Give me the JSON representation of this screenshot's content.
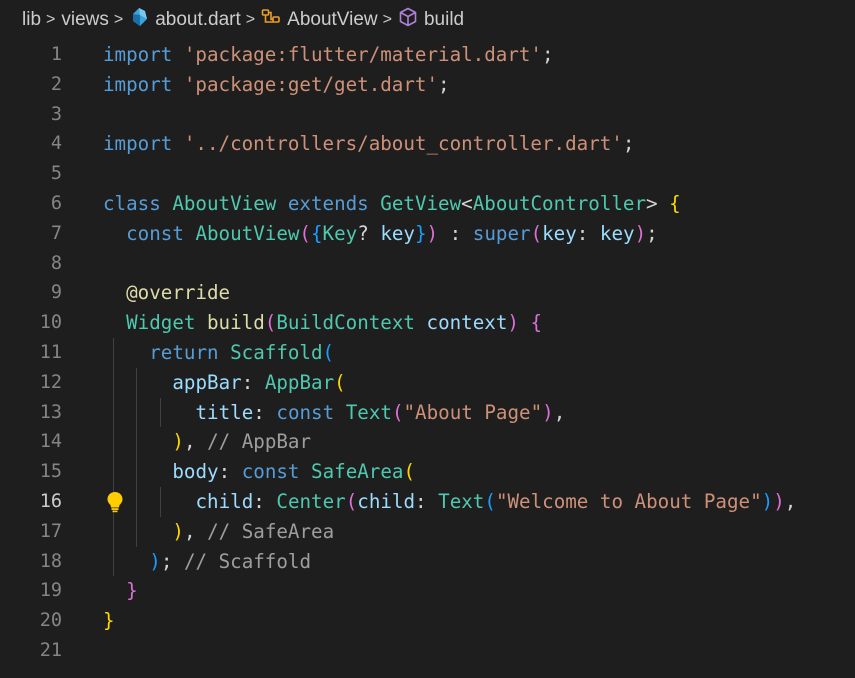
{
  "breadcrumb": {
    "items": [
      "lib",
      "views",
      "about.dart",
      "AboutView",
      "build"
    ],
    "separator": ">"
  },
  "editor": {
    "active_line": 16,
    "line_numbers": [
      "1",
      "2",
      "3",
      "4",
      "5",
      "6",
      "7",
      "8",
      "9",
      "10",
      "11",
      "12",
      "13",
      "14",
      "15",
      "16",
      "17",
      "18",
      "19",
      "20",
      "21"
    ],
    "lines": [
      "import 'package:flutter/material.dart';",
      "import 'package:get/get.dart';",
      "",
      "import '../controllers/about_controller.dart';",
      "",
      "class AboutView extends GetView<AboutController> {",
      "  const AboutView({Key? key}) : super(key: key);",
      "",
      "  @override",
      "  Widget build(BuildContext context) {",
      "    return Scaffold(",
      "      appBar: AppBar(",
      "        title: const Text(\"About Page\"),",
      "      ), // AppBar",
      "      body: const SafeArea(",
      "        child: Center(child: Text(\"Welcome to About Page\")),",
      "      ), // SafeArea",
      "    ); // Scaffold",
      "  }",
      "}",
      ""
    ]
  },
  "icons": {
    "file": "dart-file-icon",
    "class": "class-symbol-icon",
    "method": "method-cube-icon",
    "lightbulb": "lightbulb-icon"
  },
  "colors": {
    "background": "#1e1e1e",
    "keyword": "#569cd6",
    "string": "#ce9178",
    "type": "#4ec9b0",
    "function": "#dcdcaa",
    "variable": "#9cdcfe",
    "comment": "#9e9e9e",
    "bracket_gold": "#ffd700",
    "bracket_purple": "#da70d6",
    "bracket_blue": "#179fff"
  }
}
